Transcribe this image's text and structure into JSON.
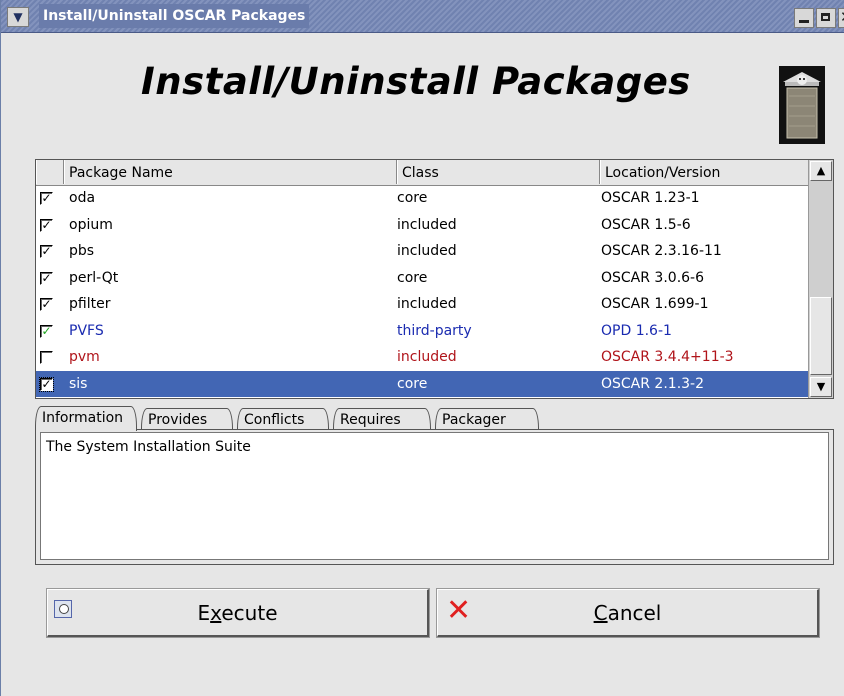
{
  "window": {
    "title": "Install/Uninstall OSCAR Packages"
  },
  "heading": "Install/Uninstall Packages",
  "table": {
    "columns": [
      "",
      "Package Name",
      "Class",
      "Location/Version"
    ],
    "rows": [
      {
        "checked": true,
        "name": "oda",
        "class": "core",
        "location": "OSCAR 1.23-1",
        "style": ""
      },
      {
        "checked": true,
        "name": "opium",
        "class": "included",
        "location": "OSCAR 1.5-6",
        "style": ""
      },
      {
        "checked": true,
        "name": "pbs",
        "class": "included",
        "location": "OSCAR 2.3.16-11",
        "style": ""
      },
      {
        "checked": true,
        "name": "perl-Qt",
        "class": "core",
        "location": "OSCAR 3.0.6-6",
        "style": ""
      },
      {
        "checked": true,
        "name": "pfilter",
        "class": "included",
        "location": "OSCAR 1.699-1",
        "style": ""
      },
      {
        "checked": true,
        "name": "PVFS",
        "class": "third-party",
        "location": "OPD 1.6-1",
        "style": "blue"
      },
      {
        "checked": false,
        "name": "pvm",
        "class": "included",
        "location": "OSCAR 3.4.4+11-3",
        "style": "red"
      },
      {
        "checked": true,
        "name": "sis",
        "class": "core",
        "location": "OSCAR 2.1.3-2",
        "style": "selected"
      }
    ]
  },
  "tabs": [
    "Information",
    "Provides",
    "Conflicts",
    "Requires",
    "Packager"
  ],
  "active_tab": "Information",
  "info_text": "The System Installation Suite",
  "buttons": {
    "execute": {
      "pre": "E",
      "mnemonic": "x",
      "post": "ecute"
    },
    "cancel": {
      "pre": "",
      "mnemonic": "C",
      "post": "ancel"
    }
  },
  "colors": {
    "selection": "#4266b4",
    "third_party": "#1a2bb0",
    "unselected": "#b0141a"
  }
}
